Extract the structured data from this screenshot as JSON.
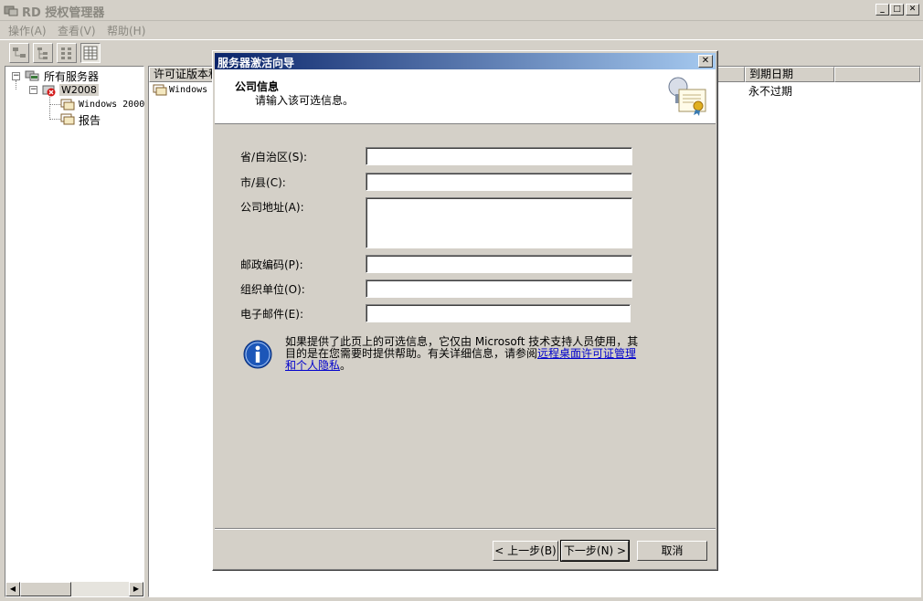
{
  "window": {
    "title": "RD 授权管理器"
  },
  "menu": [
    "操作(A)",
    "查看(V)",
    "帮助(H)"
  ],
  "tree": {
    "root": "所有服务器",
    "server": "W2008",
    "child_1": "Windows 2000",
    "child_2": "报告"
  },
  "list": {
    "col_1": "许可证版本和",
    "col_expiry": "到期日期",
    "row_name": "Windows",
    "row_expiry": "永不过期"
  },
  "dialog": {
    "title": "服务器激活向导",
    "close": "✕",
    "header_title": "公司信息",
    "header_subtitle": "请输入该可选信息。",
    "fields": {
      "province": {
        "label": "省/自治区(S):",
        "value": ""
      },
      "city": {
        "label": "市/县(C):",
        "value": ""
      },
      "address": {
        "label": "公司地址(A):",
        "value": ""
      },
      "postal": {
        "label": "邮政编码(P):",
        "value": ""
      },
      "org_unit": {
        "label": "组织单位(O):",
        "value": ""
      },
      "email": {
        "label": "电子邮件(E):",
        "value": ""
      }
    },
    "info_text": "如果提供了此页上的可选信息，它仅由 Microsoft 技术支持人员使用，其目的是在您需要时提供帮助。有关详细信息，请参阅",
    "info_link": "远程桌面许可证管理和个人隐私",
    "info_end": "。",
    "buttons": {
      "back": "< 上一步(B)",
      "next": "下一步(N) >",
      "cancel": "取消"
    }
  },
  "colors": {
    "title_gradient_start": "#0a246a",
    "title_gradient_end": "#a6caf0",
    "link": "#0000cc"
  }
}
